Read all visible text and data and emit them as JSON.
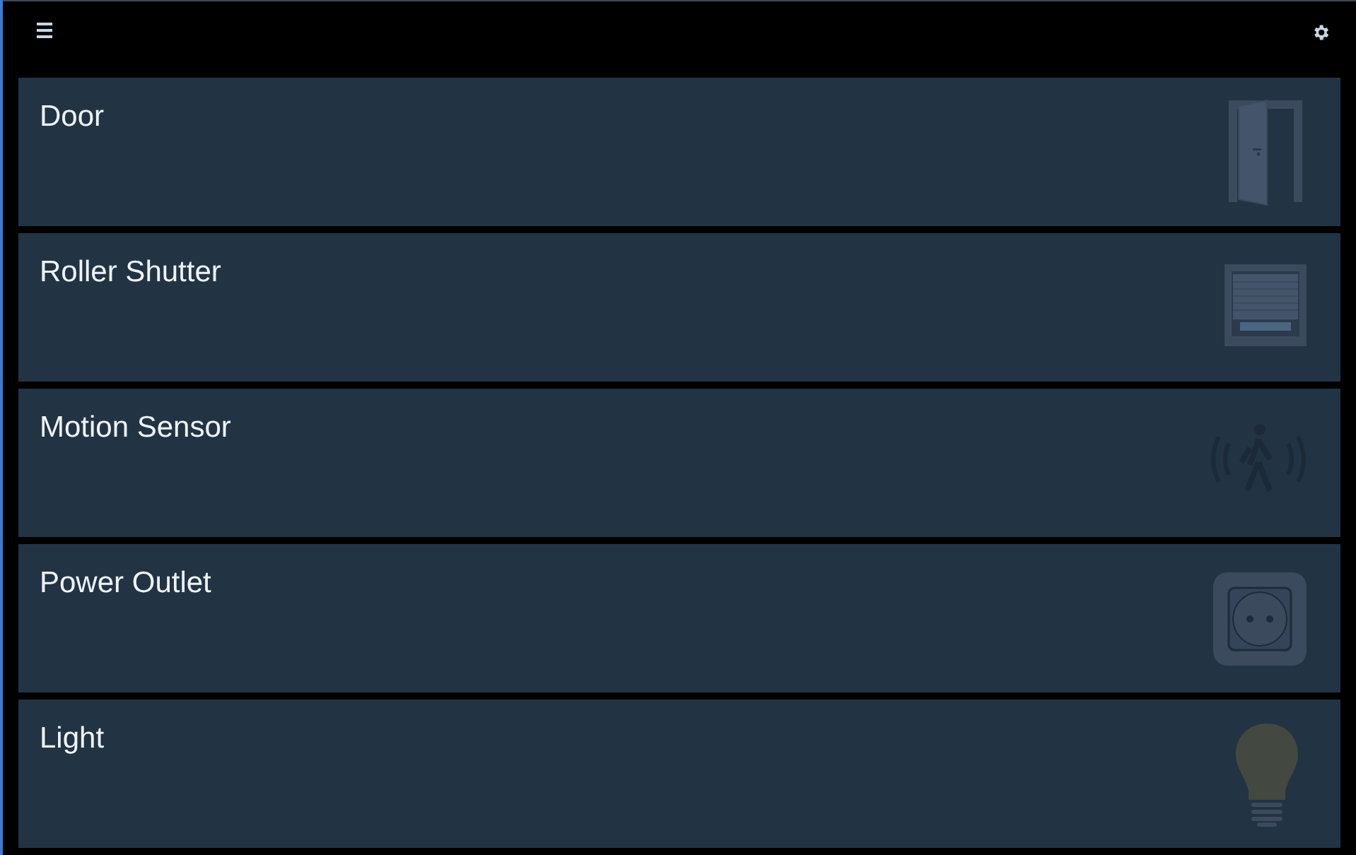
{
  "cards": [
    {
      "title": "Door",
      "kind": "door"
    },
    {
      "title": "Roller Shutter",
      "kind": "shutter"
    },
    {
      "title": "Motion Sensor",
      "kind": "motion"
    },
    {
      "title": "Power Outlet",
      "kind": "outlet"
    },
    {
      "title": "Light",
      "kind": "light"
    }
  ]
}
